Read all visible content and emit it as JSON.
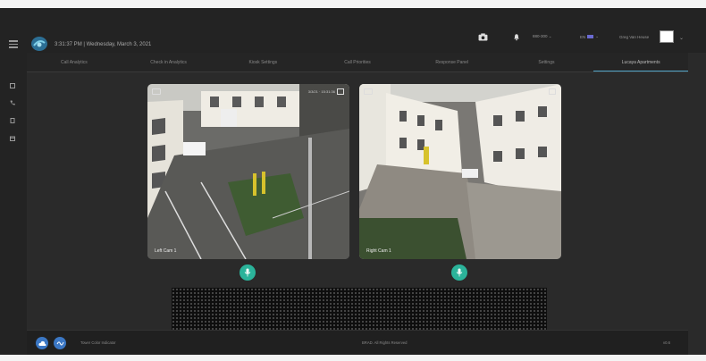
{
  "header": {
    "datetime": "3:31:37 PM | Wednesday, March 3, 2021",
    "site_selector": "880-300 ⌄",
    "language": "EN",
    "language_chevron": "⌄",
    "user_name": "Greg Van Heuse",
    "user_chevron": "⌄"
  },
  "tabs": [
    {
      "label": "Call Analytics",
      "active": false
    },
    {
      "label": "Check in Analytics",
      "active": false
    },
    {
      "label": "Kiosk Settings",
      "active": false
    },
    {
      "label": "Call Priorities",
      "active": false
    },
    {
      "label": "Response Panel",
      "active": false
    },
    {
      "label": "Settings",
      "active": false
    },
    {
      "label": "Lucaya Apartments",
      "active": true
    }
  ],
  "cameras": [
    {
      "label": "Left Cam 1",
      "timestamp": "3/3/21 · 15:31:36"
    },
    {
      "label": "Right Cam 1",
      "timestamp": ""
    }
  ],
  "footer": {
    "tower_color_indicator": "Tower Color Indicator",
    "copyright": "BRAD. All Rights Reserved",
    "version": "v0.6"
  },
  "colors": {
    "accent": "#4fa3c7",
    "mic_green": "#2bb39a",
    "footer_blue": "#3b77c4",
    "background": "#2a2a2a"
  },
  "icons": [
    "menu-icon",
    "logo-icon",
    "camera-icon",
    "bell-icon",
    "avatar",
    "home-icon",
    "phone-icon",
    "doc-icon",
    "calendar-icon",
    "mic-icon",
    "cloud-icon",
    "wave-icon"
  ]
}
